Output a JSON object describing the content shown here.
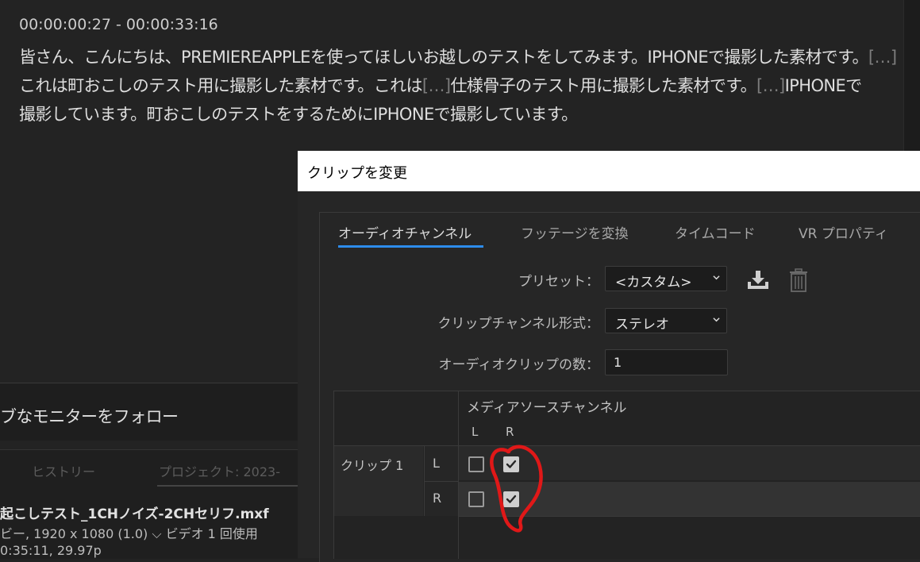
{
  "transcript": {
    "timecode_range": "00:00:00:27 - 00:00:33:16",
    "line1": {
      "text": "皆さん、こんにちは、PREMIEREAPPLEを使ってほしいお越しのテストをしてみます。IPHONEで撮影した素材です。",
      "ellipsis": "[…]"
    },
    "line2": {
      "part1": "これは町おこしのテスト用に撮影した素材です。これは",
      "ellipsis1": "[…]",
      "part2": "仕様骨子のテスト用に撮影した素材です。",
      "ellipsis2": "[…]",
      "part3": "IPHONEで"
    },
    "line3": "撮影しています。町おこしのテストをするためにIPHONEで撮影しています。"
  },
  "follow_monitor": {
    "label": "ブなモニターをフォロー"
  },
  "project_panel": {
    "tabs": {
      "history": "ヒストリー",
      "project": "プロジェクト: 2023-"
    },
    "clip_name": "起こしテスト_1CHノイズ-2CHセリフ.mxf",
    "meta_line1": "ビー, 1920 x 1080 (1.0) ⌵ ビデオ 1 回使用",
    "meta_line2": "0:35:11, 29.97p"
  },
  "dialog": {
    "title": "クリップを変更",
    "tabs": {
      "audio_channels": "オーディオチャンネル",
      "interpret_footage": "フッテージを変換",
      "timecode": "タイムコード",
      "vr_properties": "VR プロパティ"
    },
    "active_tab": "audio_channels",
    "preset": {
      "label": "プリセット：",
      "value": "<カスタム>"
    },
    "clip_channel_format": {
      "label": "クリップチャンネル形式：",
      "value": "ステレオ"
    },
    "audio_clip_count": {
      "label": "オーディオクリップの数：",
      "value": "1"
    },
    "channel_grid": {
      "media_source_header": "メディアソースチャンネル",
      "source_columns": [
        "L",
        "R"
      ],
      "clip_label": "クリップ 1",
      "rows": [
        {
          "channel": "L",
          "L_checked": false,
          "R_checked": true
        },
        {
          "channel": "R",
          "L_checked": false,
          "R_checked": true
        }
      ]
    }
  },
  "colors": {
    "accent_blue": "#2d8ceb",
    "annotation_red": "#e01818"
  },
  "icons": {
    "save_preset": "download-tray-icon",
    "delete_preset": "trash-icon",
    "dropdown": "chevron-down-icon"
  }
}
